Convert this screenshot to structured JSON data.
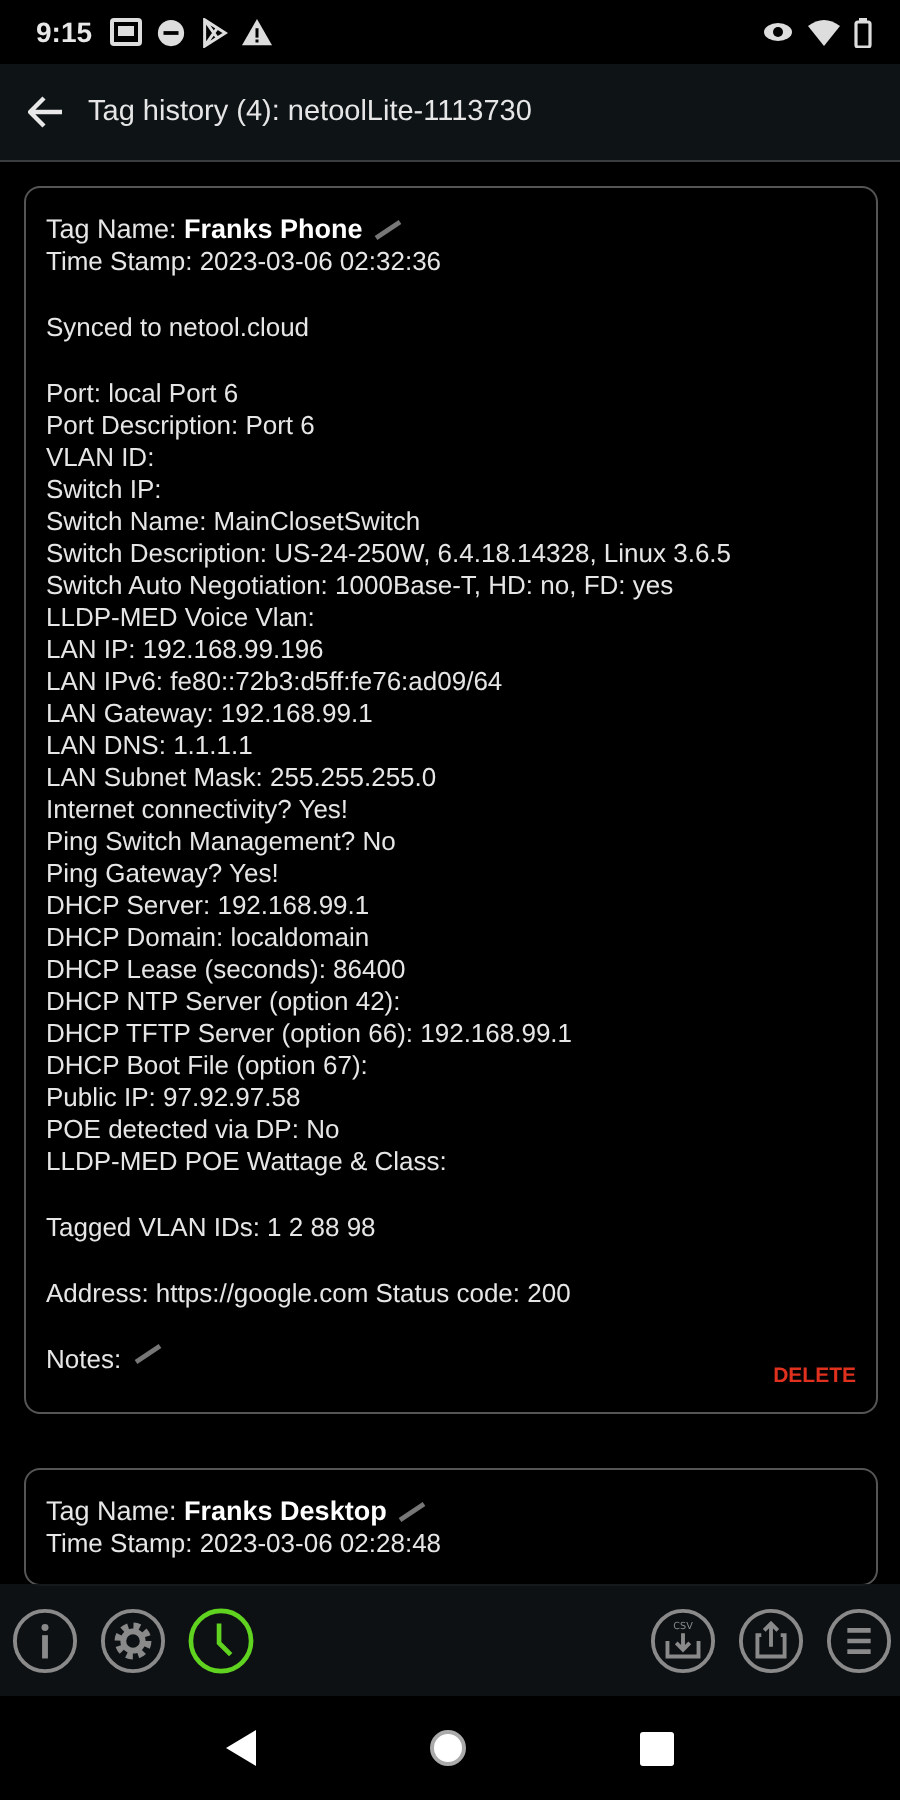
{
  "status_bar": {
    "time": "9:15"
  },
  "app_bar": {
    "title": "Tag history (4): netoolLite-1113730"
  },
  "cards": [
    {
      "tag_label": "Tag Name:",
      "tag_name": "Franks Phone",
      "sections": [
        [
          "Time Stamp: 2023-03-06 02:32:36"
        ],
        [
          "Synced to netool.cloud"
        ],
        [
          "Port: local Port 6",
          "Port Description: Port 6",
          "VLAN ID:",
          "Switch IP:",
          "Switch Name: MainClosetSwitch",
          "Switch Description: US-24-250W, 6.4.18.14328, Linux 3.6.5",
          "Switch Auto Negotiation: 1000Base-T, HD: no, FD: yes",
          "LLDP-MED Voice Vlan:",
          "LAN IP: 192.168.99.196",
          "LAN IPv6: fe80::72b3:d5ff:fe76:ad09/64",
          "LAN Gateway: 192.168.99.1",
          "LAN DNS: 1.1.1.1",
          "LAN Subnet Mask: 255.255.255.0",
          "Internet connectivity? Yes!",
          "Ping Switch Management? No",
          "Ping Gateway? Yes!",
          "DHCP Server: 192.168.99.1",
          "DHCP Domain: localdomain",
          "DHCP Lease (seconds): 86400",
          "DHCP NTP Server (option 42):",
          "DHCP TFTP Server (option 66): 192.168.99.1",
          "DHCP Boot File (option 67):",
          "Public IP: 97.92.97.58",
          "POE detected via DP: No",
          "LLDP-MED POE Wattage & Class:"
        ],
        [
          "Tagged VLAN IDs: 1 2 88 98"
        ],
        [
          "Address: https://google.com Status code: 200"
        ]
      ],
      "notes_label": "Notes:",
      "delete_label": "DELETE"
    },
    {
      "tag_label": "Tag Name:",
      "tag_name": "Franks Desktop",
      "sections": [
        [
          "Time Stamp: 2023-03-06 02:28:48"
        ]
      ]
    }
  ],
  "toolbar": {
    "left": [
      {
        "kind": "info",
        "selected": false
      },
      {
        "kind": "settings",
        "selected": false
      },
      {
        "kind": "history",
        "selected": true
      }
    ],
    "right": [
      {
        "kind": "csv",
        "label": "CSV"
      },
      {
        "kind": "share"
      },
      {
        "kind": "menu"
      }
    ]
  }
}
